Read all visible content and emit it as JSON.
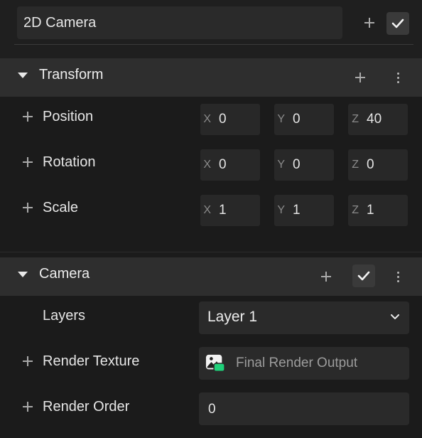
{
  "entity": {
    "name": "2D Camera"
  },
  "transform": {
    "title": "Transform",
    "rows": [
      {
        "label": "Position",
        "x": "0",
        "y": "0",
        "z": "40"
      },
      {
        "label": "Rotation",
        "x": "0",
        "y": "0",
        "z": "0"
      },
      {
        "label": "Scale",
        "x": "1",
        "y": "1",
        "z": "1"
      }
    ],
    "axis": {
      "x": "X",
      "y": "Y",
      "z": "Z"
    }
  },
  "camera": {
    "title": "Camera",
    "layers_label": "Layers",
    "layers_value": "Layer 1",
    "render_texture_label": "Render Texture",
    "render_texture_value": "Final Render Output",
    "render_order_label": "Render Order",
    "render_order_value": "0"
  },
  "colors": {
    "background": "#1b1b1b",
    "header": "#2e2e2e",
    "field": "#2a2a2a",
    "accent_green": "#1fd07a"
  }
}
